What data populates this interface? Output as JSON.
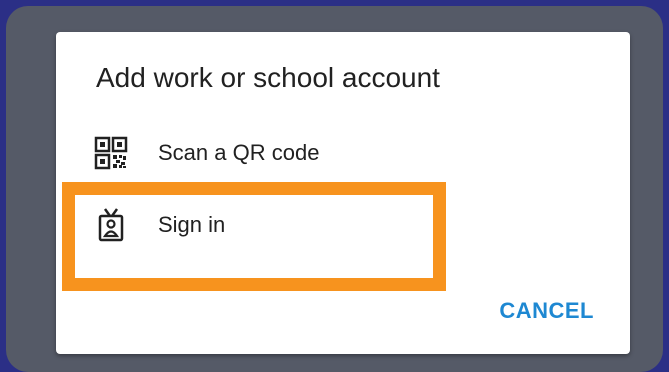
{
  "dialog": {
    "title": "Add work or school account",
    "options": [
      {
        "label": "Scan a QR code",
        "icon": "qr-code-icon"
      },
      {
        "label": "Sign in",
        "icon": "badge-icon"
      }
    ],
    "cancel_label": "CANCEL"
  },
  "colors": {
    "background": "#2b2f86",
    "highlight": "#f7931e",
    "accent": "#1e88d2"
  }
}
